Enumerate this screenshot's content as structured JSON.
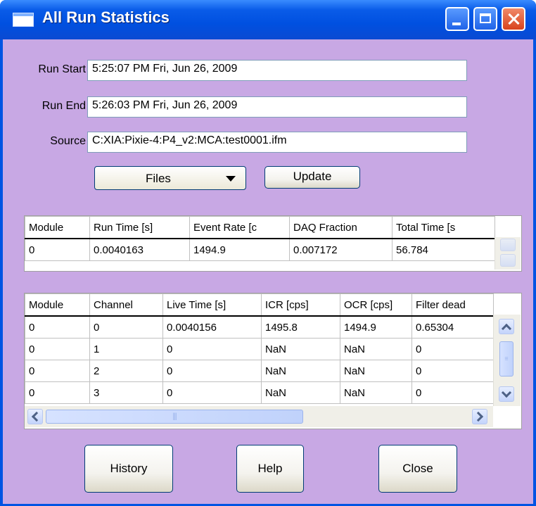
{
  "window": {
    "title": "All Run Statistics"
  },
  "fields": {
    "run_start_label": "Run Start",
    "run_start_value": "5:25:07 PM Fri, Jun 26, 2009",
    "run_end_label": "Run End",
    "run_end_value": "5:26:03 PM Fri, Jun 26, 2009",
    "source_label": "Source",
    "source_value": "C:XIA:Pixie-4:P4_v2:MCA:test0001.ifm"
  },
  "controls": {
    "files_label": "Files",
    "update_label": "Update"
  },
  "module_table": {
    "headers": [
      "Module",
      "Run Time [s]",
      "Event Rate [c",
      "DAQ Fraction",
      "Total Time [s"
    ],
    "rows": [
      [
        "0",
        "0.0040163",
        "1494.9",
        "0.007172",
        "56.784"
      ]
    ]
  },
  "channel_table": {
    "headers": [
      "Module",
      "Channel",
      "Live Time [s]",
      "ICR [cps]",
      "OCR [cps]",
      "Filter dead"
    ],
    "rows": [
      [
        "0",
        "0",
        "0.0040156",
        "1495.8",
        "1494.9",
        "0.65304"
      ],
      [
        "0",
        "1",
        "0",
        "NaN",
        "NaN",
        "0"
      ],
      [
        "0",
        "2",
        "0",
        "NaN",
        "NaN",
        "0"
      ],
      [
        "0",
        "3",
        "0",
        "NaN",
        "NaN",
        "0"
      ]
    ]
  },
  "buttons": {
    "history": "History",
    "help": "Help",
    "close": "Close"
  },
  "colors": {
    "titlebar": "#0054e3",
    "client_bg": "#c8a8e4"
  }
}
